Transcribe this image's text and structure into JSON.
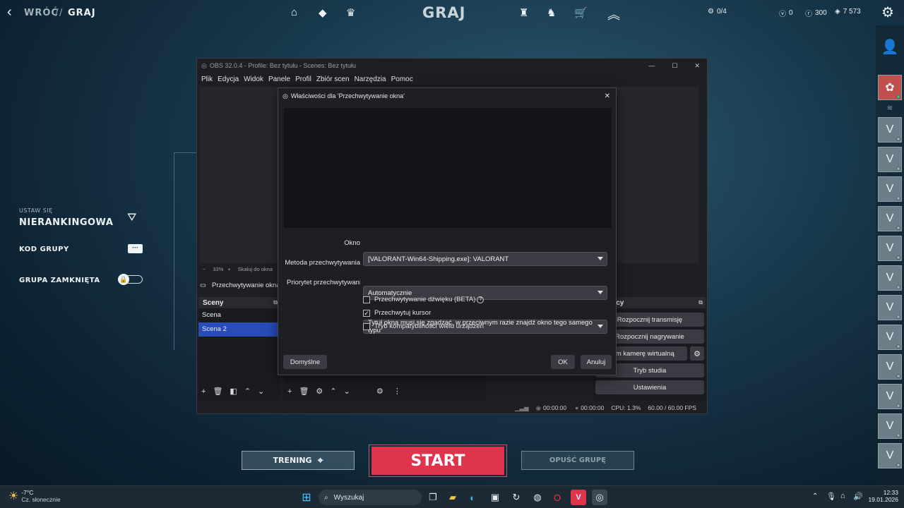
{
  "topbar": {
    "back": "WRÓĆ",
    "sep": "//",
    "crumb": "GRAJ",
    "title": "GRAJ",
    "missions": "0/4",
    "vp": "0",
    "rp": "300",
    "kc": "7 573"
  },
  "left_panel": {
    "mode_small": "USTAW SIĘ",
    "mode": "NIERANKINGOWA",
    "group_code": "KOD GRUPY",
    "group_closed": "GRUPA ZAMKNIĘTA"
  },
  "obs": {
    "title": "OBS 32.0.4 - Profile: Bez tytułu - Scenes: Bez tytułu",
    "menu": [
      "Plik",
      "Edycja",
      "Widok",
      "Panele",
      "Profil",
      "Zbiór scen",
      "Narzędzia",
      "Pomoc"
    ],
    "zoom": "33%",
    "scale": "Skaluj do okna",
    "source": "Przechwytywanie okna",
    "scenes_title": "Sceny",
    "scenes": [
      "Scena",
      "Scena 2"
    ],
    "controls_title": "terujący",
    "controls": [
      "Rozpocznij transmisję",
      "Rozpocznij nagrywanie",
      "hom kamerę wirtualną",
      "Tryb studia",
      "Ustawienia"
    ],
    "status": {
      "time1": "00:00:00",
      "time2": "00:00:00",
      "cpu": "CPU: 1.3%",
      "fps": "60.00 / 60.00 FPS"
    }
  },
  "dialog": {
    "title": "Właściwości dla 'Przechwytywanie okna'",
    "window_label": "Okno",
    "window_value": "[VALORANT-Win64-Shipping.exe]: VALORANT",
    "method_label": "Metoda przechwytywania",
    "method_value": "Automatycznie",
    "priority_label": "Priorytet przechwytywania",
    "priority_value": "Tytuł okna musi się zgadzać, w przeciwnym razie znajdź okno tego samego typu",
    "checkboxes": [
      {
        "label": "Przechwytywanie dźwięku (BETA)",
        "checked": false
      },
      {
        "label": "Przechwytuj kursor",
        "checked": true
      },
      {
        "label": "Tryb kompatybilności wielu urządzeń",
        "checked": false
      }
    ],
    "defaults": "Domyślne",
    "ok": "OK",
    "cancel": "Anuluj"
  },
  "bottom": {
    "training": "TRENING",
    "start": "START",
    "leave": "OPUŚĆ GRUPĘ"
  },
  "taskbar": {
    "temp": "-7°C",
    "weather": "Cz. słonecznie",
    "search": "Wyszukaj",
    "time": "12:33",
    "date": "19.01.2026"
  },
  "colors": {
    "start": "#e0344d",
    "obs_selected": "#284cb8"
  }
}
